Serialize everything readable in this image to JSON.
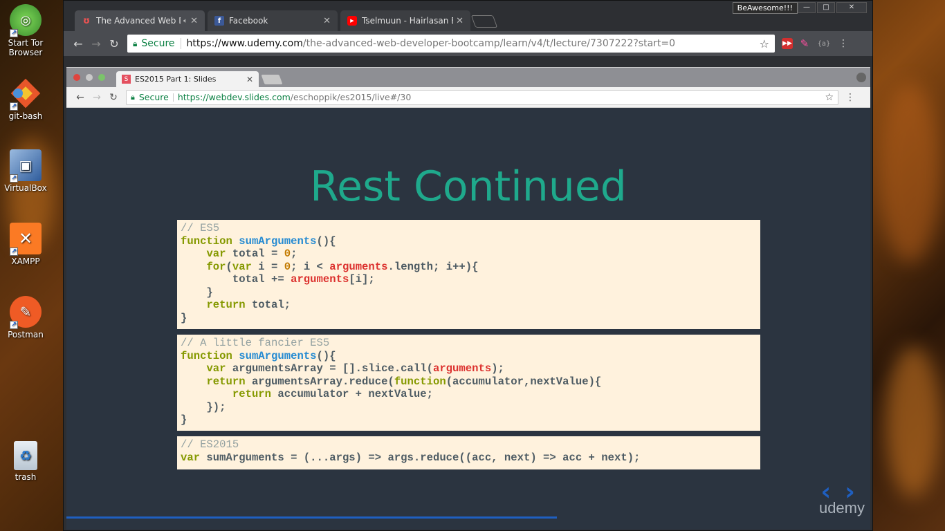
{
  "desktop": {
    "icons": [
      {
        "label": "Start Tor Browser",
        "icon": "tor-browser-icon"
      },
      {
        "label": "git-bash",
        "icon": "git-bash-icon"
      },
      {
        "label": "VirtualBox",
        "icon": "virtualbox-icon"
      },
      {
        "label": "XAMPP",
        "icon": "xampp-icon"
      },
      {
        "label": "Postman",
        "icon": "postman-icon"
      },
      {
        "label": "trash",
        "icon": "recycle-bin-icon"
      }
    ]
  },
  "outer_browser": {
    "profile_name": "BeAwesome!!!",
    "tabs": [
      {
        "label": "The Advanced Web D",
        "icon": "udemy-favicon"
      },
      {
        "label": "Facebook",
        "icon": "facebook-favicon"
      },
      {
        "label": "Tselmuun - Hairlasan Bol",
        "icon": "youtube-favicon"
      }
    ],
    "secure_label": "Secure",
    "url_host": "https://www.udemy.com",
    "url_path": "/the-advanced-web-developer-bootcamp/learn/v4/t/lecture/7307222?start=0",
    "extension_label": "{a}"
  },
  "inner_browser": {
    "tab_label": "ES2015 Part 1: Slides",
    "tab_favicon_letter": "S",
    "secure_label": "Secure",
    "url_host": "https://webdev.slides.com",
    "url_path": "/eschoppik/es2015/live#/30"
  },
  "slide": {
    "title": "Rest Continued",
    "code_blocks": [
      {
        "comment": "// ES5"
      },
      {
        "comment": "// A little fancier ES5"
      },
      {
        "comment": "// ES2015"
      }
    ],
    "brand": "udemy",
    "progress": 0.61
  },
  "colors": {
    "title_teal": "#1fa98c",
    "code_background": "#fff2dd",
    "slide_background": "#2b3440",
    "udemy_red": "#ec5252",
    "facebook_blue": "#3b5998",
    "youtube_red": "#ff0000"
  }
}
